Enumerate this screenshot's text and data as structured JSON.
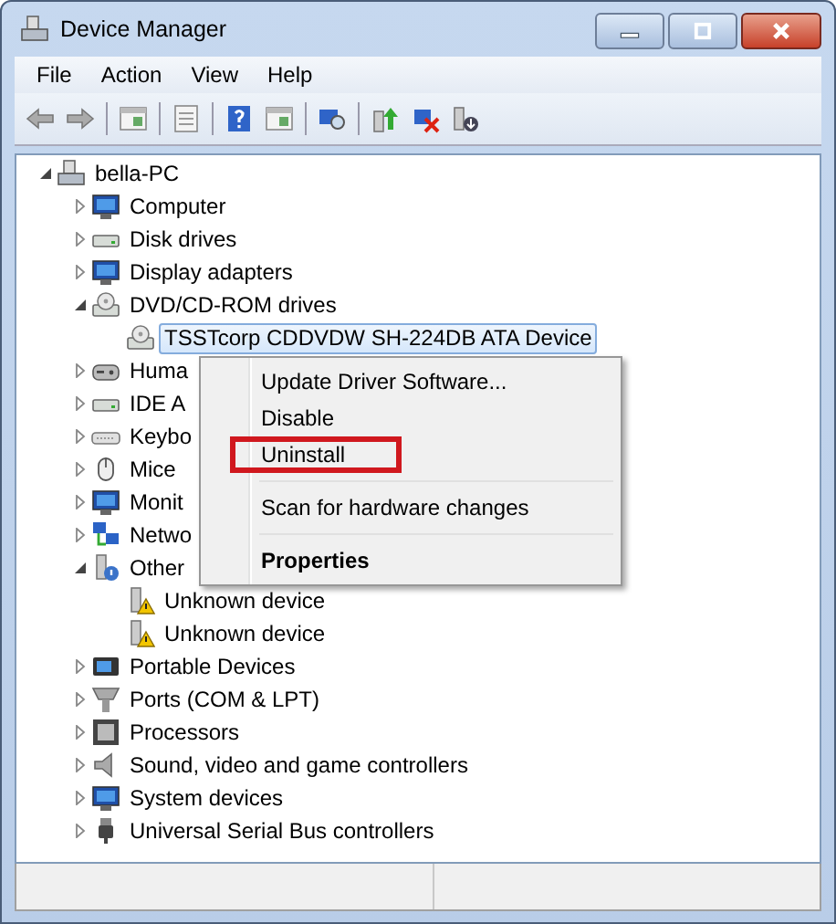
{
  "window": {
    "title": "Device Manager"
  },
  "menu_bar": [
    "File",
    "Action",
    "View",
    "Help"
  ],
  "tree": {
    "label": "bella-PC",
    "expanded": true,
    "children": [
      {
        "label": "Computer",
        "expanded": false
      },
      {
        "label": "Disk drives",
        "expanded": false
      },
      {
        "label": "Display adapters",
        "expanded": false
      },
      {
        "label": "DVD/CD-ROM drives",
        "expanded": true,
        "children": [
          {
            "label": "TSSTcorp CDDVDW SH-224DB ATA Device",
            "selected": true
          }
        ]
      },
      {
        "label": "Huma",
        "expanded": false
      },
      {
        "label": "IDE A",
        "expanded": false
      },
      {
        "label": "Keybo",
        "expanded": false
      },
      {
        "label": "Mice",
        "expanded": false
      },
      {
        "label": "Monit",
        "expanded": false
      },
      {
        "label": "Netwo",
        "expanded": false
      },
      {
        "label": "Other",
        "expanded": true,
        "children": [
          {
            "label": "Unknown device",
            "selected": false
          },
          {
            "label": "Unknown device",
            "selected": false
          }
        ]
      },
      {
        "label": "Portable Devices",
        "expanded": false
      },
      {
        "label": "Ports (COM & LPT)",
        "expanded": false
      },
      {
        "label": "Processors",
        "expanded": false
      },
      {
        "label": "Sound, video and game controllers",
        "expanded": false
      },
      {
        "label": "System devices",
        "expanded": false
      },
      {
        "label": "Universal Serial Bus controllers",
        "expanded": false
      }
    ]
  },
  "context_menu": [
    {
      "kind": "item",
      "label": "Update Driver Software...",
      "bold": false,
      "annotated": false
    },
    {
      "kind": "item",
      "label": "Disable",
      "bold": false,
      "annotated": false
    },
    {
      "kind": "item",
      "label": "Uninstall",
      "bold": false,
      "annotated": true
    },
    {
      "kind": "separator"
    },
    {
      "kind": "item",
      "label": "Scan for hardware changes",
      "bold": false,
      "annotated": false
    },
    {
      "kind": "separator"
    },
    {
      "kind": "item",
      "label": "Properties",
      "bold": true,
      "annotated": false
    }
  ]
}
